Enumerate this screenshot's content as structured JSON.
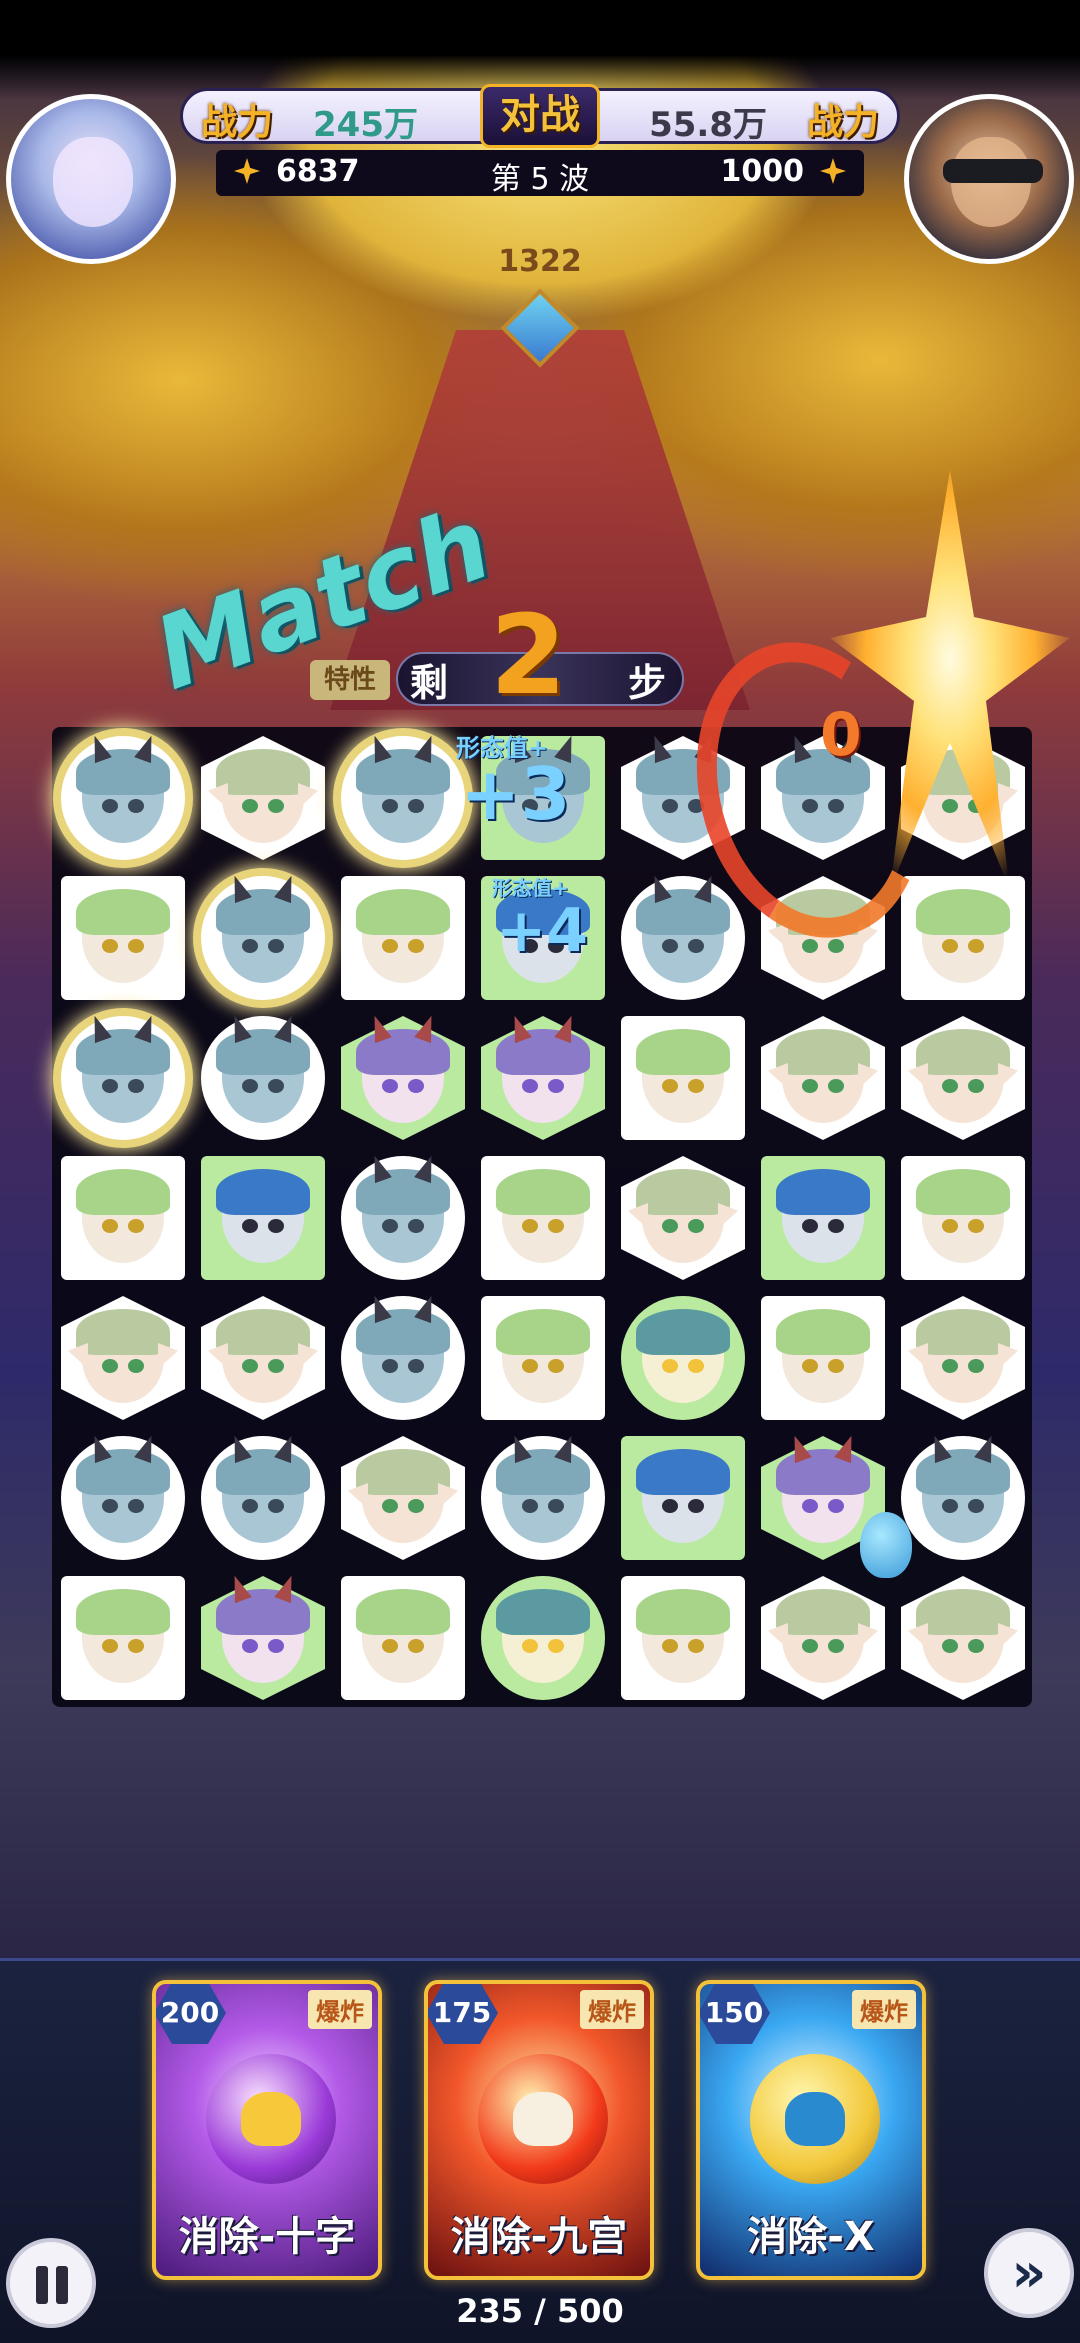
{
  "hud": {
    "power_label": "战力",
    "left_power": "245万",
    "right_power": "55.8万",
    "vs_label": "对战",
    "left_score": "6837",
    "right_score": "1000",
    "wave": "第 5 波",
    "boss_value": "1322"
  },
  "steps": {
    "special_tag": "特性",
    "prefix": "剩",
    "count": "2",
    "suffix": "步"
  },
  "effects": {
    "match_text": "Match",
    "combo_digit": "0",
    "bonus1_label": "形态值+",
    "bonus1_value": "+3",
    "bonus2_label": "形态值+",
    "bonus2_value": "+4"
  },
  "board": {
    "rows": [
      [
        [
          "dragon",
          "circle",
          0,
          1
        ],
        [
          "elf",
          "hex",
          0,
          0
        ],
        [
          "dragon",
          "circle",
          0,
          1
        ],
        [
          "dragon",
          "square",
          1,
          0
        ],
        [
          "dragon",
          "hex",
          0,
          0
        ],
        [
          "dragon",
          "hex",
          0,
          0
        ],
        [
          "elf",
          "hex",
          0,
          0
        ]
      ],
      [
        [
          "green",
          "square",
          0,
          0
        ],
        [
          "dragon",
          "circle",
          0,
          1
        ],
        [
          "green",
          "square",
          0,
          0
        ],
        [
          "blue",
          "square",
          1,
          0
        ],
        [
          "dragon",
          "circle",
          0,
          0
        ],
        [
          "elf",
          "hex",
          0,
          0
        ],
        [
          "green",
          "square",
          0,
          0
        ]
      ],
      [
        [
          "dragon",
          "circle",
          0,
          1
        ],
        [
          "dragon",
          "circle",
          0,
          0
        ],
        [
          "demon",
          "hex",
          1,
          0
        ],
        [
          "demon",
          "hex",
          1,
          0
        ],
        [
          "green",
          "square",
          0,
          0
        ],
        [
          "elf",
          "hex",
          0,
          0
        ],
        [
          "elf",
          "hex",
          0,
          0
        ]
      ],
      [
        [
          "green",
          "square",
          0,
          0
        ],
        [
          "blue",
          "square",
          1,
          0
        ],
        [
          "dragon",
          "circle",
          0,
          0
        ],
        [
          "green",
          "square",
          0,
          0
        ],
        [
          "elf",
          "hex",
          0,
          0
        ],
        [
          "blue",
          "square",
          1,
          0
        ],
        [
          "green",
          "square",
          0,
          0
        ]
      ],
      [
        [
          "elf",
          "hex",
          0,
          0
        ],
        [
          "elf",
          "hex",
          0,
          0
        ],
        [
          "dragon",
          "circle",
          0,
          0
        ],
        [
          "green",
          "square",
          0,
          0
        ],
        [
          "wolf",
          "circle",
          1,
          0
        ],
        [
          "green",
          "square",
          0,
          0
        ],
        [
          "elf",
          "hex",
          0,
          0
        ]
      ],
      [
        [
          "dragon",
          "circle",
          0,
          0
        ],
        [
          "dragon",
          "circle",
          0,
          0
        ],
        [
          "elf",
          "hex",
          0,
          0
        ],
        [
          "dragon",
          "circle",
          0,
          0
        ],
        [
          "blue",
          "square",
          1,
          0
        ],
        [
          "demon",
          "hex",
          1,
          0
        ],
        [
          "dragon",
          "circle",
          0,
          0
        ]
      ],
      [
        [
          "green",
          "square",
          0,
          0
        ],
        [
          "demon",
          "hex",
          1,
          0
        ],
        [
          "green",
          "square",
          0,
          0
        ],
        [
          "wolf",
          "circle",
          1,
          0
        ],
        [
          "green",
          "square",
          0,
          0
        ],
        [
          "elf",
          "hex",
          0,
          0
        ],
        [
          "elf",
          "hex",
          0,
          0
        ]
      ]
    ]
  },
  "skills": [
    {
      "cost": "200",
      "tag": "爆炸",
      "label": "消除-十字",
      "icon": "purple-bomb-icon"
    },
    {
      "cost": "175",
      "tag": "爆炸",
      "label": "消除-九宫",
      "icon": "fire-bomb-icon"
    },
    {
      "cost": "150",
      "tag": "爆炸",
      "label": "消除-X",
      "icon": "blue-bomb-icon"
    }
  ],
  "energy": "235 / 500",
  "colors": {
    "accent": "#f4b327",
    "power_green": "#2f9a8a",
    "steps_orange": "#f2a21e"
  }
}
